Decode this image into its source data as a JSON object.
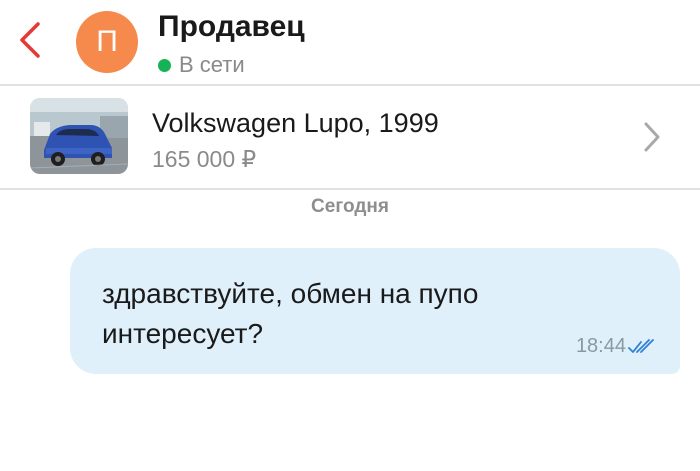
{
  "header": {
    "back_icon": "chevron-left-icon",
    "avatar_letter": "П",
    "avatar_color": "#f58a4c",
    "seller_name": "Продавец",
    "status": "В сети",
    "status_color": "#16b356"
  },
  "listing": {
    "title": "Volkswagen Lupo, 1999",
    "price": "165 000 ₽",
    "thumbnail_icon": "car-photo",
    "chevron_icon": "chevron-right-icon"
  },
  "chat": {
    "date_label": "Сегодня",
    "messages": [
      {
        "text": "здравствуйте, обмен на пупо интересует?",
        "time": "18:44",
        "status_icon": "double-check-icon",
        "outgoing": true,
        "bubble_color": "#dff0fb"
      }
    ]
  },
  "colors": {
    "accent_red": "#e53935",
    "check_blue": "#2f80d6"
  }
}
